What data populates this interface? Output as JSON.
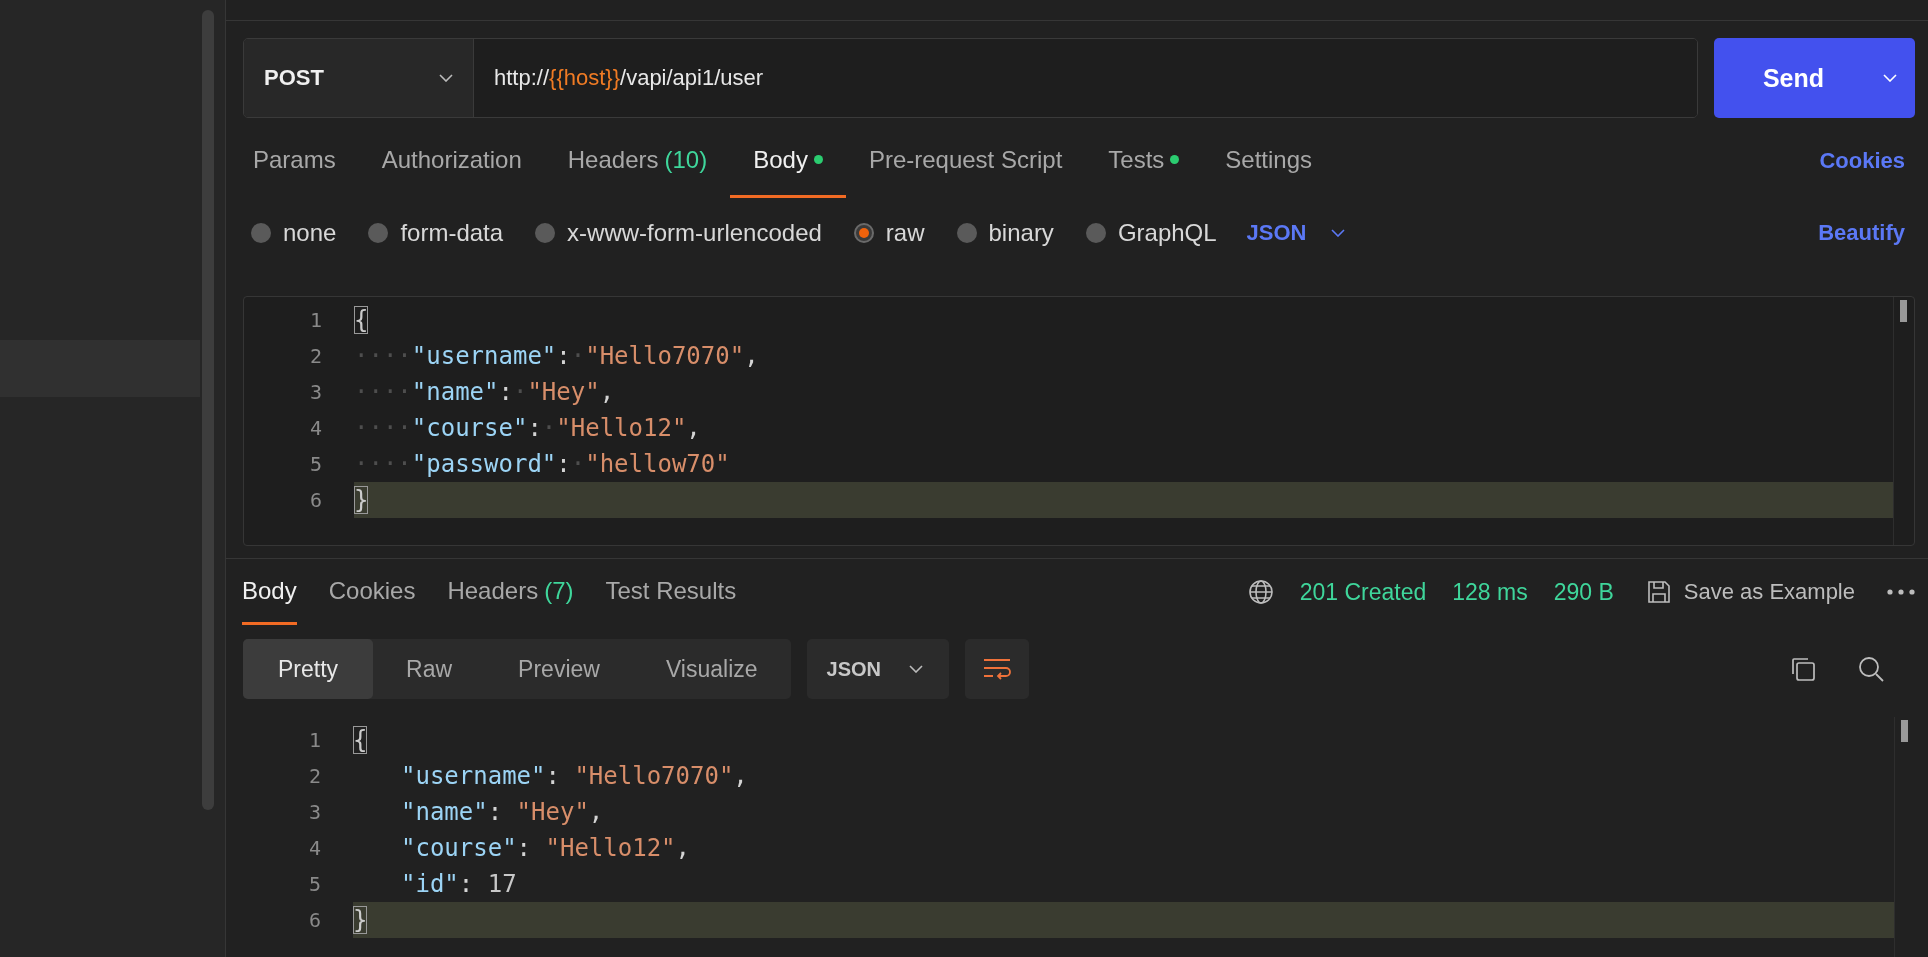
{
  "request": {
    "method": "POST",
    "url": [
      {
        "kind": "plain",
        "text": "http://"
      },
      {
        "kind": "variable",
        "text": "{{host}}"
      },
      {
        "kind": "plain",
        "text": "/vapi/api1/user"
      }
    ],
    "send_label": "Send"
  },
  "request_tabs": [
    {
      "label": "Params",
      "selected": false,
      "dot": false
    },
    {
      "label": "Authorization",
      "selected": false,
      "dot": false
    },
    {
      "label": "Headers",
      "count": "(10)",
      "selected": false,
      "dot": false
    },
    {
      "label": "Body",
      "selected": true,
      "dot": true
    },
    {
      "label": "Pre-request Script",
      "selected": false,
      "dot": false
    },
    {
      "label": "Tests",
      "selected": false,
      "dot": true
    },
    {
      "label": "Settings",
      "selected": false,
      "dot": false
    }
  ],
  "cookies_link": "Cookies",
  "body_types": [
    {
      "label": "none",
      "selected": false
    },
    {
      "label": "form-data",
      "selected": false
    },
    {
      "label": "x-www-form-urlencoded",
      "selected": false
    },
    {
      "label": "raw",
      "selected": true
    },
    {
      "label": "binary",
      "selected": false
    },
    {
      "label": "GraphQL",
      "selected": false
    }
  ],
  "body_language": "JSON",
  "beautify_link": "Beautify",
  "request_editor": {
    "lines": [
      {
        "number": "1",
        "current": false,
        "tokens": [
          {
            "kind": "bracket",
            "text": "{"
          }
        ]
      },
      {
        "number": "2",
        "current": false,
        "tokens": [
          {
            "kind": "ws",
            "text": "····"
          },
          {
            "kind": "key",
            "text": "\"username\""
          },
          {
            "kind": "punct",
            "text": ":"
          },
          {
            "kind": "ws",
            "text": "·"
          },
          {
            "kind": "string",
            "text": "\"Hello7070\""
          },
          {
            "kind": "punct",
            "text": ","
          }
        ]
      },
      {
        "number": "3",
        "current": false,
        "tokens": [
          {
            "kind": "ws",
            "text": "····"
          },
          {
            "kind": "key",
            "text": "\"name\""
          },
          {
            "kind": "punct",
            "text": ":"
          },
          {
            "kind": "ws",
            "text": "·"
          },
          {
            "kind": "string",
            "text": "\"Hey\""
          },
          {
            "kind": "punct",
            "text": ","
          }
        ]
      },
      {
        "number": "4",
        "current": false,
        "tokens": [
          {
            "kind": "ws",
            "text": "····"
          },
          {
            "kind": "key",
            "text": "\"course\""
          },
          {
            "kind": "punct",
            "text": ":"
          },
          {
            "kind": "ws",
            "text": "·"
          },
          {
            "kind": "string",
            "text": "\"Hello12\""
          },
          {
            "kind": "punct",
            "text": ","
          }
        ]
      },
      {
        "number": "5",
        "current": false,
        "tokens": [
          {
            "kind": "ws",
            "text": "····"
          },
          {
            "kind": "key",
            "text": "\"password\""
          },
          {
            "kind": "punct",
            "text": ":"
          },
          {
            "kind": "ws",
            "text": "·"
          },
          {
            "kind": "string",
            "text": "\"hellow70\""
          }
        ]
      },
      {
        "number": "6",
        "current": true,
        "tokens": [
          {
            "kind": "bracket",
            "text": "}"
          }
        ]
      }
    ]
  },
  "response_tabs": [
    {
      "label": "Body",
      "selected": true
    },
    {
      "label": "Cookies",
      "selected": false
    },
    {
      "label": "Headers",
      "count": "(7)",
      "selected": false
    },
    {
      "label": "Test Results",
      "selected": false
    }
  ],
  "response_status": {
    "status": "201 Created",
    "time": "128 ms",
    "size": "290 B",
    "save_label": "Save as Example"
  },
  "view_modes": [
    {
      "label": "Pretty",
      "selected": true
    },
    {
      "label": "Raw",
      "selected": false
    },
    {
      "label": "Preview",
      "selected": false
    },
    {
      "label": "Visualize",
      "selected": false
    }
  ],
  "response_language": "JSON",
  "wrap_on": true,
  "response_editor": {
    "lines": [
      {
        "number": "1",
        "current": false,
        "tokens": [
          {
            "kind": "bracket",
            "text": "{"
          }
        ],
        "children": [
          {
            "number": "2",
            "current": false,
            "tokens": [
              {
                "kind": "key",
                "text": "\"username\""
              },
              {
                "kind": "punct",
                "text": ": "
              },
              {
                "kind": "string",
                "text": "\"Hello7070\""
              },
              {
                "kind": "punct",
                "text": ","
              }
            ]
          },
          {
            "number": "3",
            "current": false,
            "tokens": [
              {
                "kind": "key",
                "text": "\"name\""
              },
              {
                "kind": "punct",
                "text": ": "
              },
              {
                "kind": "string",
                "text": "\"Hey\""
              },
              {
                "kind": "punct",
                "text": ","
              }
            ]
          },
          {
            "number": "4",
            "current": false,
            "tokens": [
              {
                "kind": "key",
                "text": "\"course\""
              },
              {
                "kind": "punct",
                "text": ": "
              },
              {
                "kind": "string",
                "text": "\"Hello12\""
              },
              {
                "kind": "punct",
                "text": ","
              }
            ]
          },
          {
            "number": "5",
            "current": false,
            "tokens": [
              {
                "kind": "key",
                "text": "\"id\""
              },
              {
                "kind": "punct",
                "text": ": "
              },
              {
                "kind": "number",
                "text": "17"
              }
            ]
          }
        ]
      },
      {
        "number": "6",
        "current": true,
        "tokens": [
          {
            "kind": "bracket",
            "text": "}"
          }
        ]
      }
    ]
  }
}
